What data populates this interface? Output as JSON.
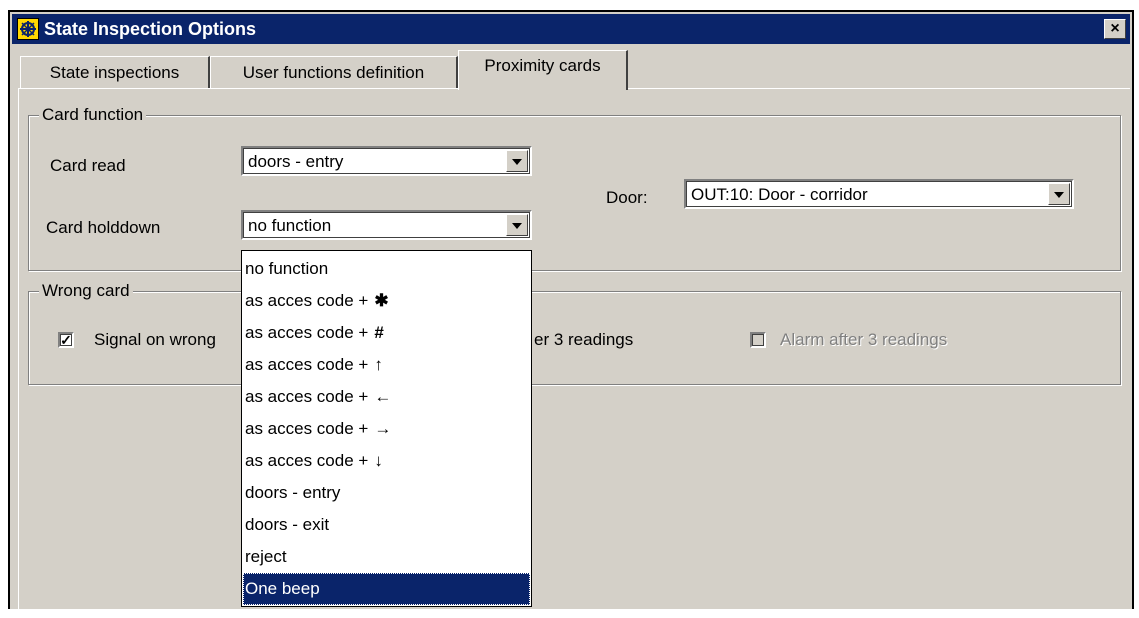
{
  "window": {
    "title": "State Inspection Options",
    "close_label": "×"
  },
  "tabs": [
    "State inspections",
    "User functions definition",
    "Proximity cards"
  ],
  "card_function": {
    "legend": "Card function",
    "card_read_label": "Card read",
    "card_read_value": "doors - entry",
    "card_holddown_label": "Card holddown",
    "card_holddown_value": "no function",
    "door_label": "Door:",
    "door_value": "OUT:10: Door - corridor"
  },
  "wrong_card": {
    "legend": "Wrong card",
    "signal_label": "Signal on wrong",
    "signal_checked": "✓",
    "readings_text": "er 3 readings",
    "alarm_label": "Alarm after 3 readings"
  },
  "dropdown": {
    "items": [
      {
        "text": "no function",
        "glyph": ""
      },
      {
        "text": "as acces code +",
        "glyph": "✱"
      },
      {
        "text": "as acces code +",
        "glyph": "#"
      },
      {
        "text": "as acces code +",
        "glyph": "↑"
      },
      {
        "text": "as acces code +",
        "glyph": "←"
      },
      {
        "text": "as acces code +",
        "glyph": "→"
      },
      {
        "text": "as acces code +",
        "glyph": "↓"
      },
      {
        "text": "doors - entry",
        "glyph": ""
      },
      {
        "text": "doors - exit",
        "glyph": ""
      },
      {
        "text": "reject",
        "glyph": ""
      },
      {
        "text": "One beep",
        "glyph": ""
      }
    ],
    "selected_index": 10
  },
  "colors": {
    "titlebar": "#0a246a",
    "face": "#d4d0c8",
    "selection": "#0a246a"
  }
}
